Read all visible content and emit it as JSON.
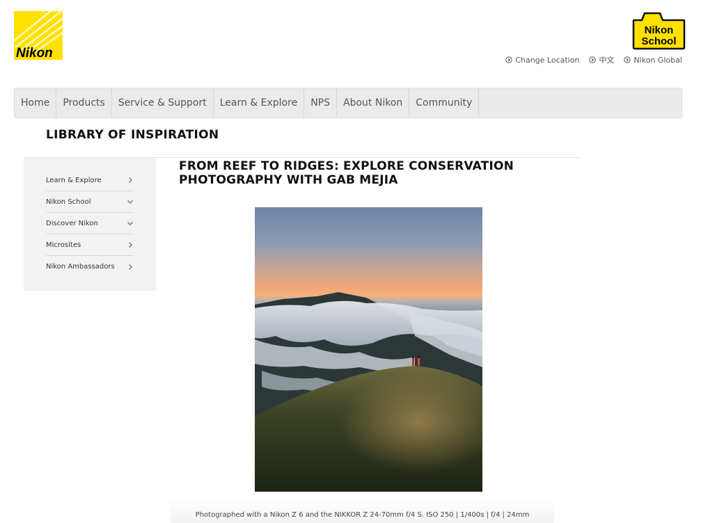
{
  "header": {
    "brand_logo_text": "Nikon",
    "school_logo_text": [
      "Nikon",
      "School"
    ],
    "utility_links": [
      {
        "label": "Change Location"
      },
      {
        "label": "中文"
      },
      {
        "label": "Nikon Global"
      }
    ]
  },
  "nav": {
    "items": [
      {
        "label": "Home"
      },
      {
        "label": "Products"
      },
      {
        "label": "Service & Support"
      },
      {
        "label": "Learn & Explore"
      },
      {
        "label": "NPS"
      },
      {
        "label": "About Nikon"
      },
      {
        "label": "Community"
      }
    ]
  },
  "section": {
    "title": "LIBRARY OF INSPIRATION"
  },
  "sidebar": {
    "items": [
      {
        "label": "Learn & Explore",
        "icon": "chevron-right-icon"
      },
      {
        "label": "Nikon School",
        "icon": "chevron-down-icon"
      },
      {
        "label": "Discover Nikon",
        "icon": "chevron-down-icon"
      },
      {
        "label": "Microsites",
        "icon": "chevron-right-icon"
      },
      {
        "label": "Nikon Ambassadors",
        "icon": "chevron-right-icon"
      }
    ]
  },
  "article": {
    "title": "FROM REEF TO RIDGES: EXPLORE CONSERVATION PHOTOGRAPHY WITH GAB MEJIA",
    "photo_caption": "Photographed with a Nikon Z 6 and the NIKKOR Z 24-70mm f/4 S. ISO 250 | 1/400s | f/4 | 24mm"
  },
  "colors": {
    "brand_yellow": "#FFE100",
    "nav_background": "#EBEBEB",
    "sidebar_background": "#F2F2F2"
  }
}
